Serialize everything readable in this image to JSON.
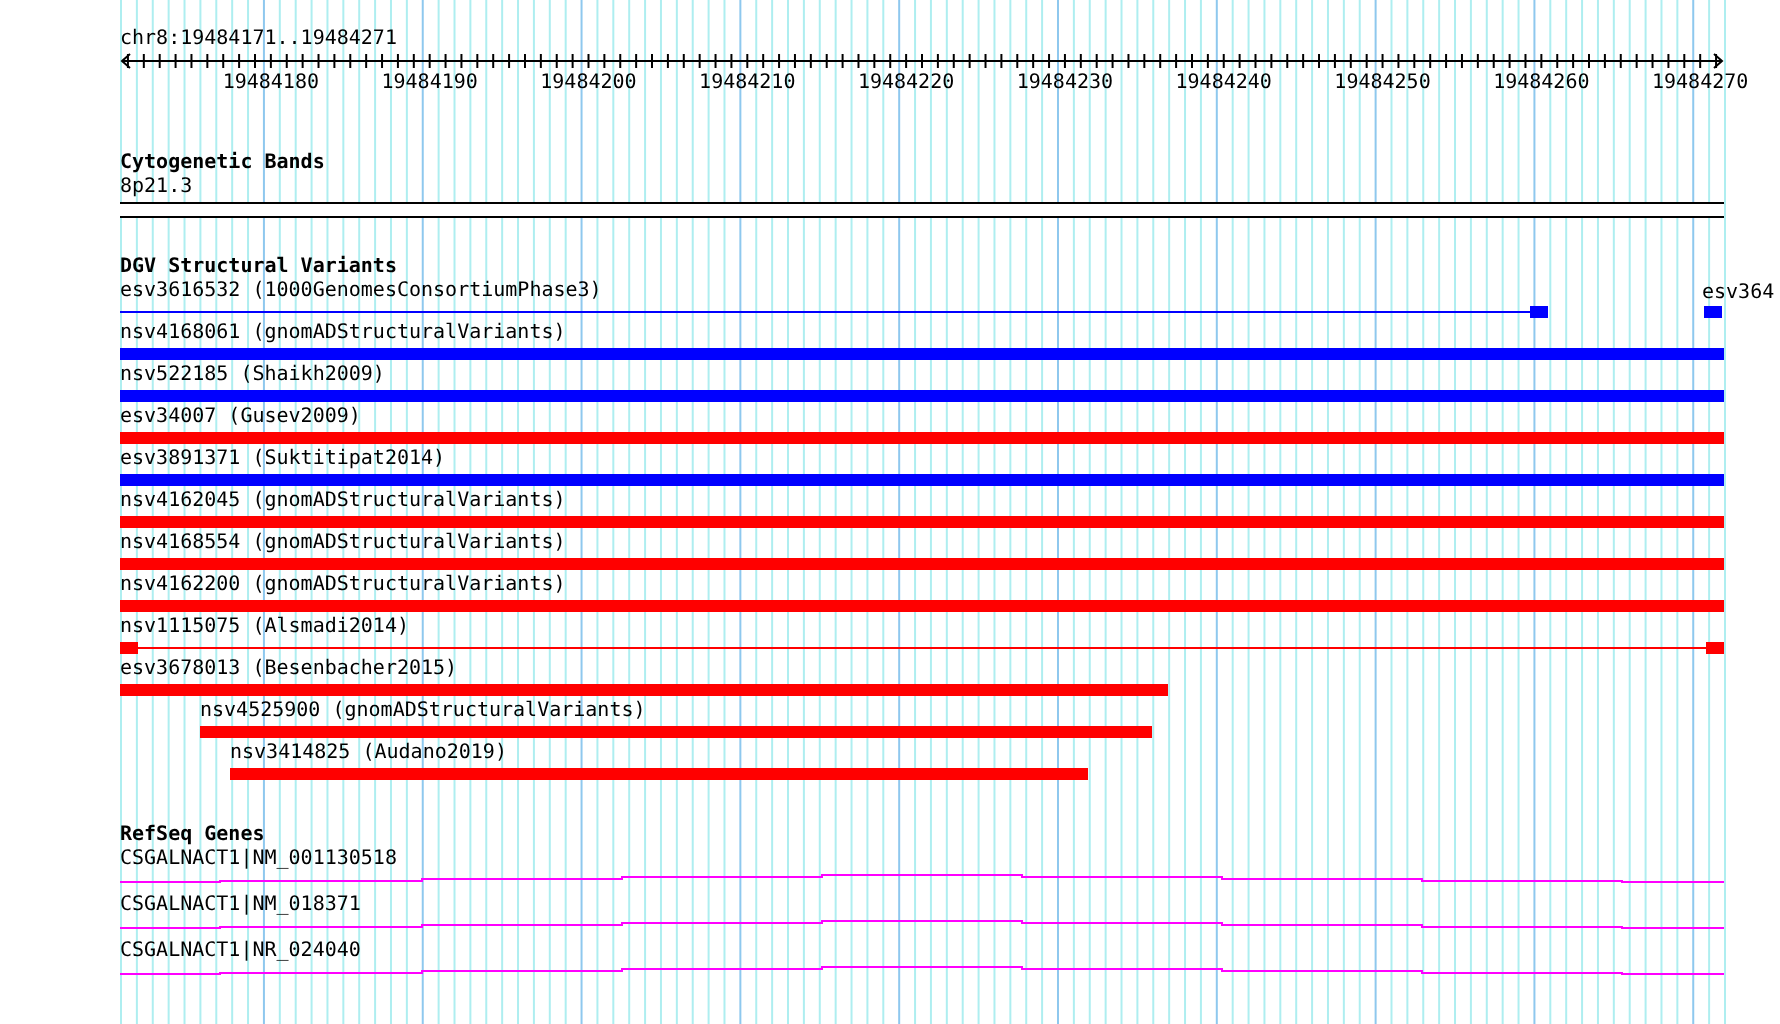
{
  "ruler": {
    "position": "chr8:19484171..19484271",
    "ticks": [
      "19484180",
      "19484190",
      "19484200",
      "19484210",
      "19484220",
      "19484230",
      "19484240",
      "19484250",
      "19484260",
      "19484270"
    ]
  },
  "cytogenetic_bands": {
    "title": "Cytogenetic Bands",
    "band": "8p21.3"
  },
  "dgv_structural_variants": {
    "title": "DGV Structural Variants",
    "edge_variant": {
      "label": "esv364",
      "color": "#0000ff"
    },
    "variants": [
      {
        "label": "esv3616532 (1000GenomesConsortiumPhase3)",
        "color": "#0000ff",
        "kind": "split"
      },
      {
        "label": "nsv4168061 (gnomADStructuralVariants)",
        "color": "#0000ff",
        "kind": "bar"
      },
      {
        "label": "nsv522185 (Shaikh2009)",
        "color": "#0000ff",
        "kind": "bar"
      },
      {
        "label": "esv34007 (Gusev2009)",
        "color": "#ff0000",
        "kind": "bar"
      },
      {
        "label": "esv3891371 (Suktitipat2014)",
        "color": "#0000ff",
        "kind": "bar"
      },
      {
        "label": "nsv4162045 (gnomADStructuralVariants)",
        "color": "#ff0000",
        "kind": "bar"
      },
      {
        "label": "nsv4168554 (gnomADStructuralVariants)",
        "color": "#ff0000",
        "kind": "bar"
      },
      {
        "label": "nsv4162200 (gnomADStructuralVariants)",
        "color": "#ff0000",
        "kind": "bar"
      },
      {
        "label": "nsv1115075 (Alsmadi2014)",
        "color": "#ff0000",
        "kind": "split-both"
      },
      {
        "label": "esv3678013 (Besenbacher2015)",
        "color": "#ff0000",
        "kind": "bar"
      },
      {
        "label": "nsv4525900 (gnomADStructuralVariants)",
        "color": "#ff0000",
        "kind": "bar"
      },
      {
        "label": "nsv3414825 (Audano2019)",
        "color": "#ff0000",
        "kind": "bar"
      }
    ]
  },
  "refseq_genes": {
    "title": "RefSeq Genes",
    "genes": [
      {
        "label": "CSGALNACT1|NM_001130518"
      },
      {
        "label": "CSGALNACT1|NM_018371"
      },
      {
        "label": "CSGALNACT1|NR_024040"
      }
    ]
  }
}
